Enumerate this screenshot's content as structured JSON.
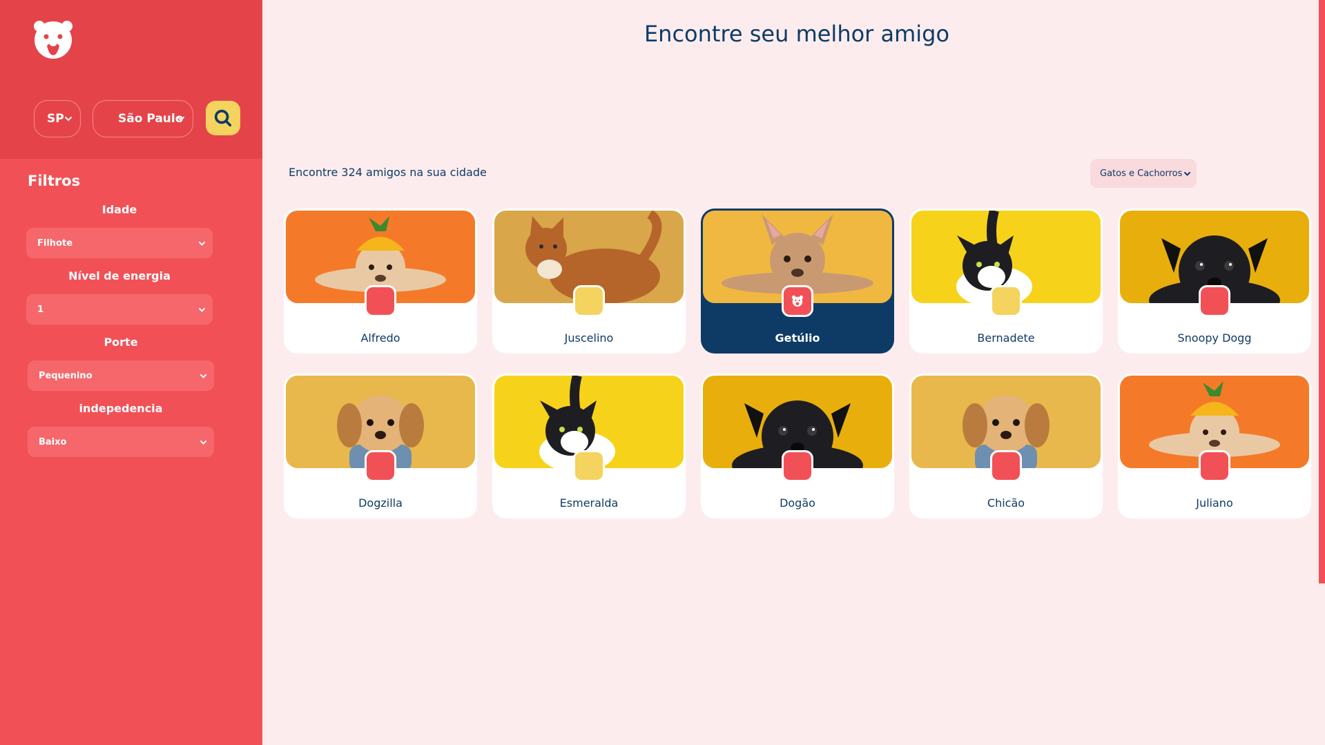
{
  "sidebar": {
    "logo_icon": "paw-face-icon",
    "state_select": {
      "value": "SP"
    },
    "city_select": {
      "value": "São Paulo"
    },
    "search_icon": "search-icon",
    "filters_title": "Filtros",
    "filters": [
      {
        "label": "Idade",
        "value": "Filhote"
      },
      {
        "label": "Nível de energia",
        "value": "1"
      },
      {
        "label": "Porte",
        "value": "Pequenino"
      },
      {
        "label": "indepedencia",
        "value": "Baixo"
      }
    ]
  },
  "main": {
    "title": "Encontre seu melhor amigo",
    "count_text": "Encontre 324 amigos na sua cidade",
    "type_select": {
      "value": "Gatos e Cachorros"
    },
    "pets": [
      {
        "name": "Alfredo",
        "badge_color": "#F15156",
        "photo_bg": "#F47A2A",
        "animal": "dog-hat"
      },
      {
        "name": "Juscelino",
        "badge_color": "#F4D35E",
        "photo_bg": "#D9A64A",
        "animal": "cat"
      },
      {
        "name": "Getúlio",
        "badge_color": "#F15156",
        "photo_bg": "#F0B840",
        "animal": "frenchie",
        "selected": true
      },
      {
        "name": "Bernadete",
        "badge_color": "#F4D35E",
        "photo_bg": "#F7D21A",
        "animal": "cat-bw"
      },
      {
        "name": "Snoopy Dogg",
        "badge_color": "#F15156",
        "photo_bg": "#E8AE0C",
        "animal": "pug"
      },
      {
        "name": "Dogzilla",
        "badge_color": "#F15156",
        "photo_bg": "#E8B84C",
        "animal": "shihtzu"
      },
      {
        "name": "Esmeralda",
        "badge_color": "#F4D35E",
        "photo_bg": "#F7D21A",
        "animal": "cat-bw"
      },
      {
        "name": "Dogão",
        "badge_color": "#F15156",
        "photo_bg": "#E8AE0C",
        "animal": "pug"
      },
      {
        "name": "Chicão",
        "badge_color": "#F15156",
        "photo_bg": "#E8B84C",
        "animal": "shihtzu"
      },
      {
        "name": "Juliano",
        "badge_color": "#F15156",
        "photo_bg": "#F47A2A",
        "animal": "dog-hat"
      }
    ]
  },
  "colors": {
    "primary_red": "#F15156",
    "dark_red": "#E44449",
    "navy": "#0D3B66",
    "yellow": "#F4D35E",
    "background": "#FDECEE"
  }
}
